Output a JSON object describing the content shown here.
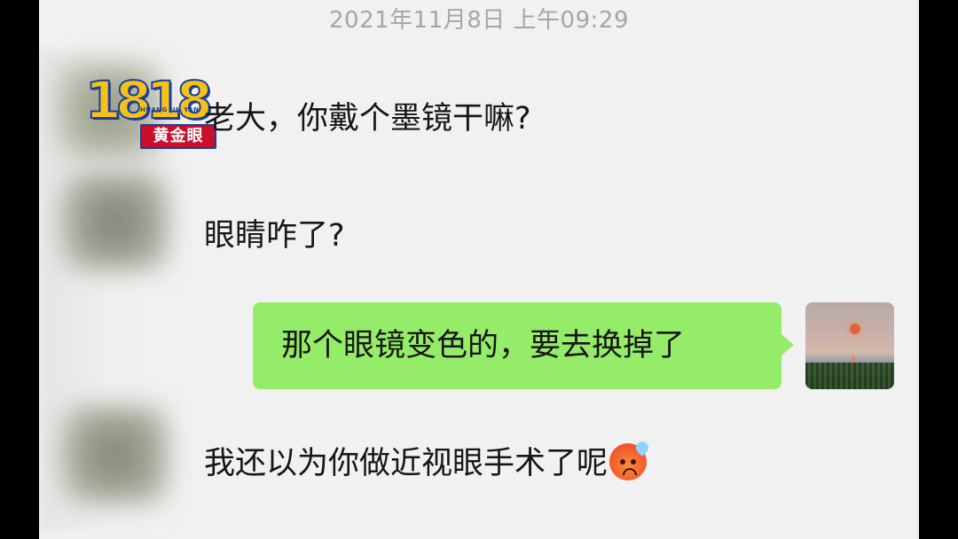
{
  "chat": {
    "timestamp": "2021年11月8日 上午09:29",
    "messages": [
      {
        "side": "left",
        "text": "老大，你戴个墨镜干嘛?"
      },
      {
        "side": "left",
        "text": "眼睛咋了?"
      },
      {
        "side": "right",
        "text": "那个眼镜变色的，要去换掉了"
      },
      {
        "side": "left",
        "text": "我还以为你做近视眼手术了呢",
        "emoji": "hot-sweat-face-emoji"
      }
    ]
  },
  "watermark": {
    "digits": "1818",
    "subtitle": "HUANG JIN YAN",
    "name": "黄金眼"
  },
  "colors": {
    "screen_bg": "#f1f1f1",
    "outgoing_bubble": "#95ec69",
    "timestamp_text": "#a6a6a6",
    "logo_red": "#c8102e",
    "logo_gold": "#f6c21a",
    "logo_blue": "#1d3f9a"
  }
}
